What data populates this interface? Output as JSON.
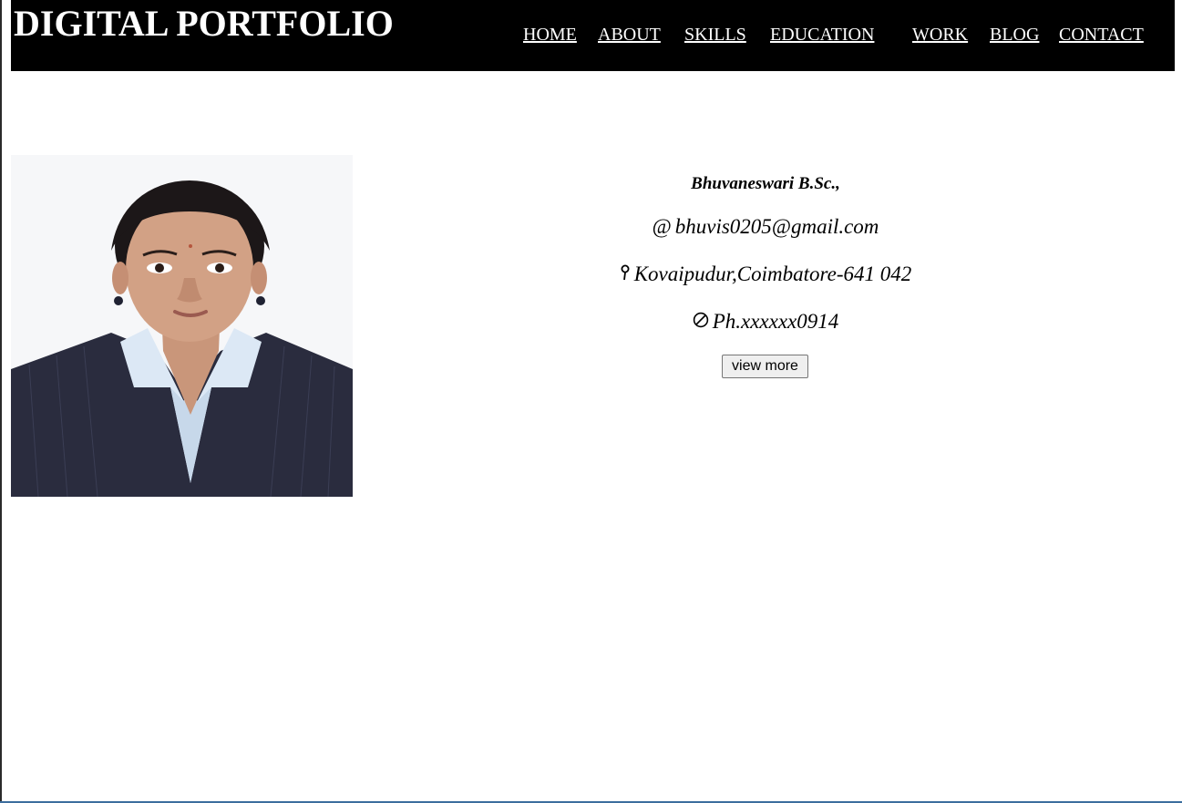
{
  "header": {
    "title": "DIGITAL PORTFOLIO",
    "nav": [
      "HOME",
      "ABOUT",
      "SKILLS",
      "EDUCATION",
      "WORK",
      "BLOG",
      "CONTACT"
    ]
  },
  "profile": {
    "name": "Bhuvaneswari B.Sc.,",
    "email": "bhuvis0205@gmail.com",
    "email_glyph": "@",
    "address": "Kovaipudur,Coimbatore-641 042",
    "phone": "Ph.xxxxxx0914",
    "button_label": "view more"
  },
  "icons": {
    "email": "at-icon",
    "address": "map-pin-icon",
    "phone": "phone-icon"
  },
  "colors": {
    "header_bg": "#000000",
    "header_text": "#ffffff",
    "page_bg": "#ffffff"
  }
}
